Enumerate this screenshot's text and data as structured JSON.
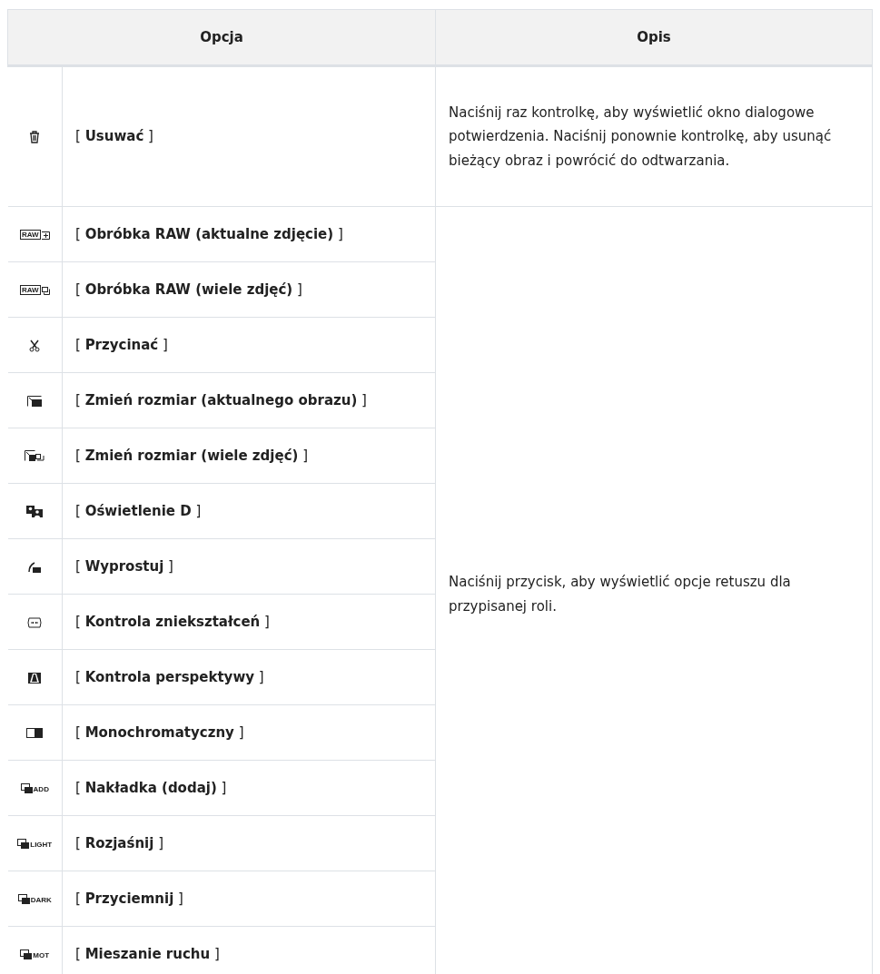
{
  "table": {
    "columns": [
      "Opcja",
      "Opis"
    ],
    "rows": [
      {
        "kind": "trash",
        "option": "[ **Usuwać** ]",
        "description": "Naciśnij raz kontrolkę, aby wyświetlić okno dialogowe potwierdzenia. Naciśnij ponownie kontrolkę, aby usunąć bieżący obraz i powrócić do odtwarzania."
      },
      {
        "kind": "raw-plus",
        "icon_label": "RAW",
        "option": "[ **Obróbka RAW (aktualne zdjęcie)** ]",
        "description": "Naciśnij przycisk, aby wyświetlić opcje retuszu dla przypisanej roli."
      },
      {
        "kind": "raw-multi",
        "icon_label": "RAW",
        "option": "[ **Obróbka RAW (wiele zdjęć)** ]"
      },
      {
        "kind": "scissors",
        "option": "[ **Przycinać** ]"
      },
      {
        "kind": "resize",
        "option": "[ **Zmień rozmiar (aktualnego obrazu)** ]"
      },
      {
        "kind": "resize-multi",
        "option": "[ **Zmień rozmiar (wiele zdjęć)** ]"
      },
      {
        "kind": "d-lighting",
        "option": "[ **Oświetlenie D** ]"
      },
      {
        "kind": "straighten",
        "option": "[ **Wyprostuj** ]"
      },
      {
        "kind": "distortion",
        "option": "[ **Kontrola zniekształceń** ]"
      },
      {
        "kind": "perspective",
        "option": "[ **Kontrola perspektywy** ]"
      },
      {
        "kind": "monochrome",
        "option": "[ **Monochromatyczny** ]"
      },
      {
        "kind": "overlay",
        "icon_label": "ADD",
        "option": "[ **Nakładka (dodaj)** ]"
      },
      {
        "kind": "overlay",
        "icon_label": "LIGHT",
        "option": "[ **Rozjaśnij** ]"
      },
      {
        "kind": "overlay",
        "icon_label": "DARK",
        "option": "[ **Przyciemnij** ]"
      },
      {
        "kind": "overlay",
        "icon_label": "MOT",
        "option": "[ **Mieszanie ruchu** ]"
      }
    ]
  }
}
